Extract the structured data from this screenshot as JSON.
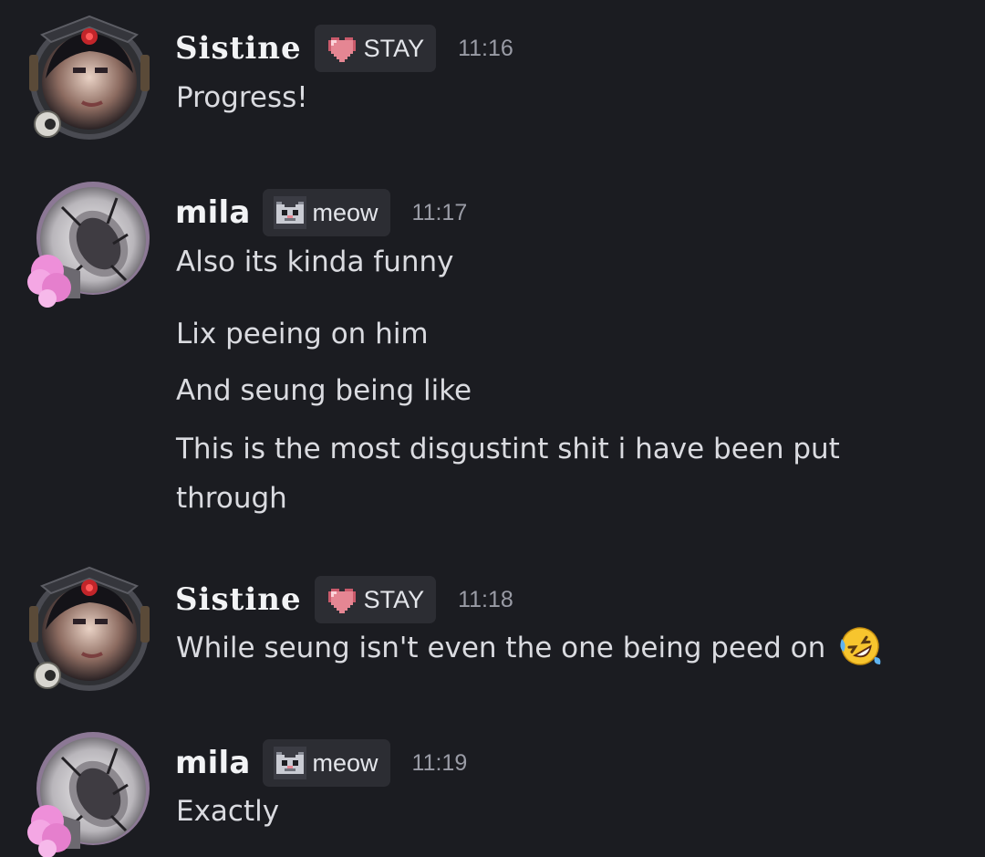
{
  "messages": [
    {
      "user": "Sistine",
      "tag_label": "STAY",
      "tag_icon": "pixel-heart-icon",
      "time": "11:16",
      "lines": [
        "Progress!"
      ]
    },
    {
      "user": "mila",
      "tag_label": "meow",
      "tag_icon": "pixel-cat-icon",
      "time": "11:17",
      "lines": [
        "Also its kinda funny",
        "Lix peeing on him",
        "And seung being like",
        "This is the most disgustint shit i have been put",
        "through"
      ]
    },
    {
      "user": "Sistine",
      "tag_label": "STAY",
      "tag_icon": "pixel-heart-icon",
      "time": "11:18",
      "lines": [
        "While seung isn't even the one being peed on"
      ],
      "emoji": "rolling-on-floor-laughing-emoji"
    },
    {
      "user": "mila",
      "tag_label": "meow",
      "tag_icon": "pixel-cat-icon",
      "time": "11:19",
      "lines": [
        "Exactly"
      ]
    }
  ],
  "colors": {
    "background": "#1b1c21",
    "tag_background": "#2c2d33",
    "text": "#dadbe0",
    "timestamp": "#9a9ca6",
    "username": "#f2f3f5"
  }
}
